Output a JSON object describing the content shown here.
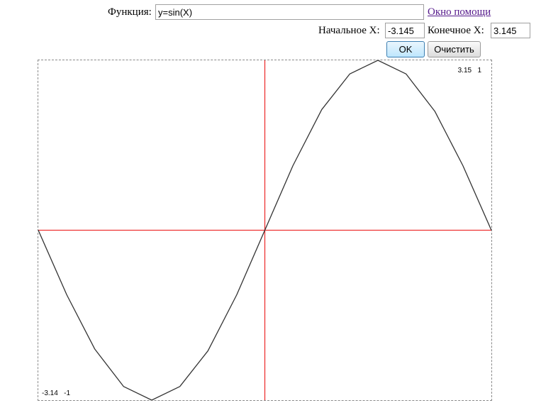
{
  "form": {
    "function_label": "Функция:",
    "function_value": "y=sin(X)",
    "help_link": "Окно помощи",
    "start_label": "Начальное X:",
    "start_value": "-3.145",
    "end_label": "Конечное X:",
    "end_value": "3.145",
    "ok_label": "OK",
    "clear_label": "Очистить"
  },
  "plot": {
    "max_label_x": "3.15",
    "max_label_y": "1",
    "min_label_x": "-3.14",
    "min_label_y": "-1"
  },
  "colors": {
    "axis": "#ee3333",
    "curve": "#333333",
    "border": "#8a8a8a"
  },
  "chart_data": {
    "type": "line",
    "function": "y=sin(X)",
    "xlim": [
      -3.145,
      3.145
    ],
    "ylim": [
      -1,
      1
    ],
    "series": [
      {
        "x": [
          -3.145,
          -2.75,
          -2.36,
          -1.96,
          -1.57,
          -1.18,
          -0.79,
          -0.39,
          0,
          0.39,
          0.79,
          1.18,
          1.57,
          1.96,
          2.36,
          2.75,
          3.145
        ],
        "y": [
          0,
          -0.38,
          -0.7,
          -0.92,
          -1.0,
          -0.92,
          -0.71,
          -0.38,
          0,
          0.38,
          0.71,
          0.92,
          1.0,
          0.92,
          0.7,
          0.38,
          0
        ]
      }
    ]
  }
}
